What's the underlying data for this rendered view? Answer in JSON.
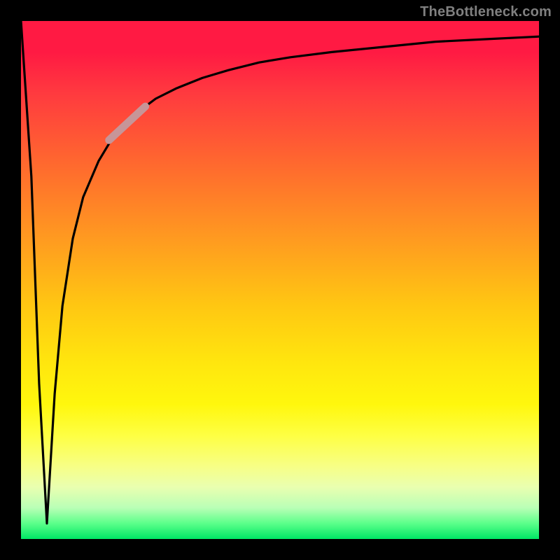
{
  "watermark": "TheBottleneck.com",
  "colors": {
    "frame": "#000000",
    "curve": "#000000",
    "highlight": "#c79598",
    "watermark": "#808080"
  },
  "chart_data": {
    "type": "line",
    "title": "",
    "xlabel": "",
    "ylabel": "",
    "xlim": [
      0,
      100
    ],
    "ylim": [
      0,
      100
    ],
    "grid": false,
    "legend": false,
    "note": "No tick labels visible; values below are estimated from pixel positions on a 0–100 normalized axis (origin bottom-left). Curve dips to near 0 around x≈5 then rises and asymptotes near y≈97.",
    "series": [
      {
        "name": "curve",
        "x": [
          0,
          2,
          3.5,
          5,
          6.5,
          8,
          10,
          12,
          15,
          18,
          22,
          26,
          30,
          35,
          40,
          46,
          52,
          60,
          70,
          80,
          90,
          100
        ],
        "y": [
          100,
          70,
          30,
          3,
          28,
          45,
          58,
          66,
          73,
          78,
          82,
          85,
          87,
          89,
          90.5,
          92,
          93,
          94,
          95,
          96,
          96.5,
          97
        ]
      }
    ],
    "highlight_segment": {
      "name": "highlight",
      "x": [
        17,
        24
      ],
      "y": [
        77,
        83.5
      ]
    }
  }
}
